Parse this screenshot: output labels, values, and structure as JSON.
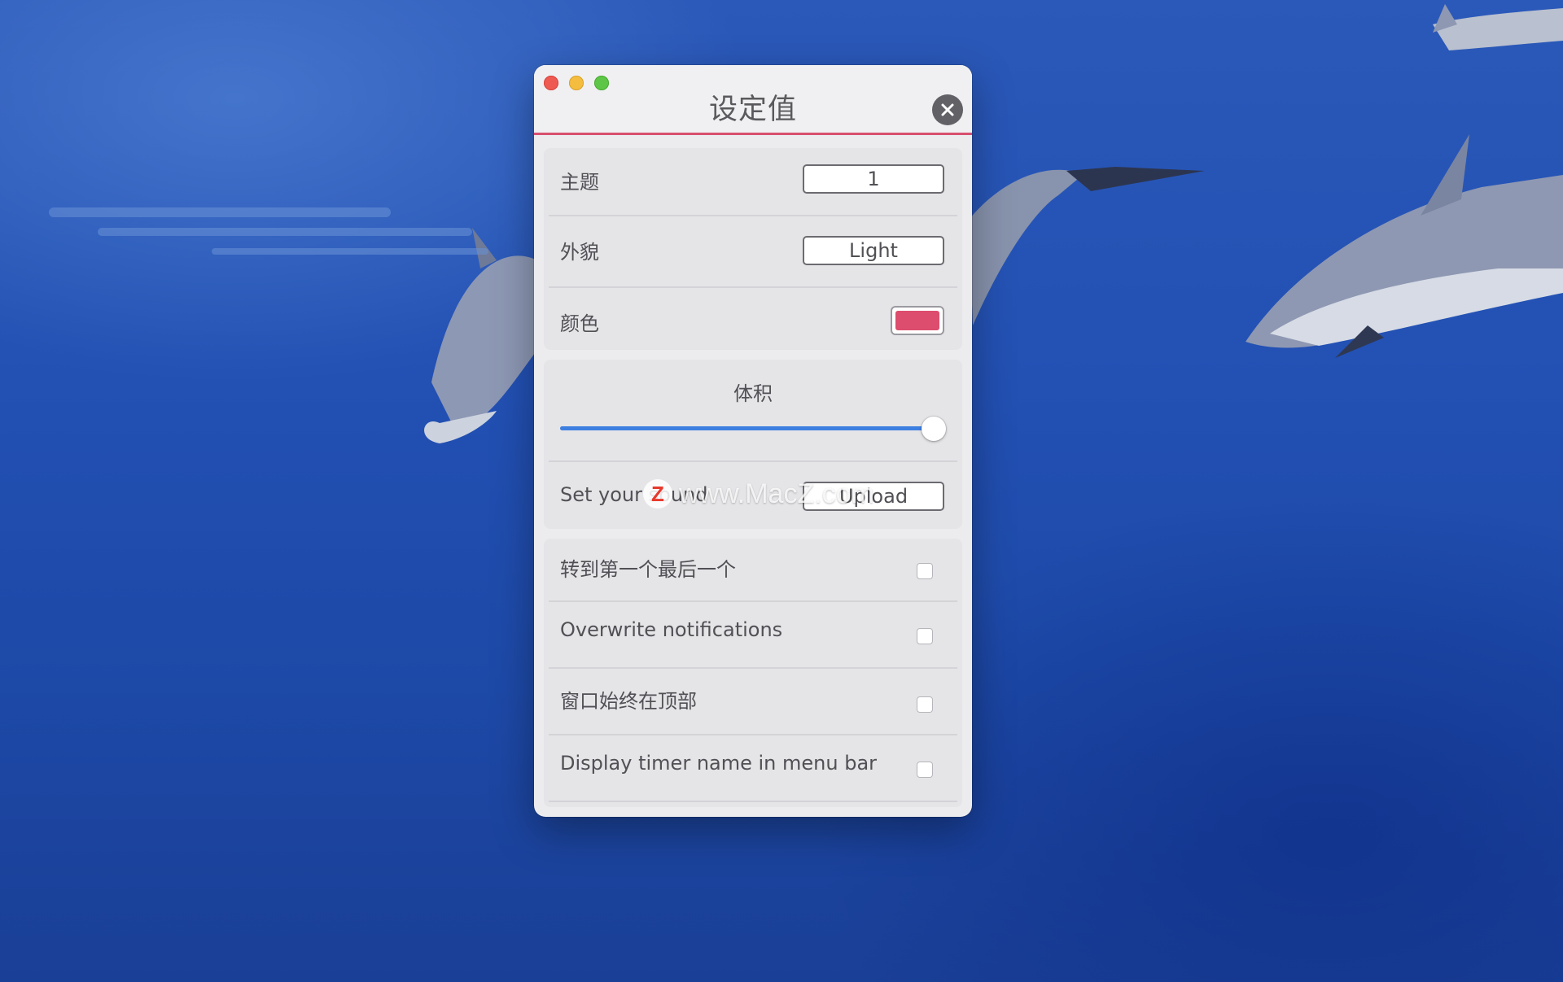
{
  "window": {
    "title": "设定值"
  },
  "appearance_card": {
    "theme": {
      "label": "主题",
      "value": "1"
    },
    "appearance": {
      "label": "外貌",
      "value": "Light"
    },
    "color": {
      "label": "颜色",
      "value": "#dc4d6e"
    }
  },
  "sound_card": {
    "volume": {
      "label": "体积",
      "level_percent": 100
    },
    "sound": {
      "label": "Set your sound",
      "button_label": "Upload"
    }
  },
  "options_card": {
    "items": [
      {
        "label": "转到第一个最后一个",
        "checked": false
      },
      {
        "label": "Overwrite notifications",
        "checked": false
      },
      {
        "label": "窗口始终在顶部",
        "checked": false
      },
      {
        "label": "Display timer name in menu bar",
        "checked": false
      }
    ]
  },
  "watermark": {
    "logo_letter": "Z",
    "text": "www.MacZ.com"
  },
  "colors": {
    "accent": "#dc4d6e",
    "slider": "#3d7fe0",
    "close_red": "#ee5a52",
    "minimize_yellow": "#f5bd3f",
    "zoom_green": "#5ec646"
  }
}
